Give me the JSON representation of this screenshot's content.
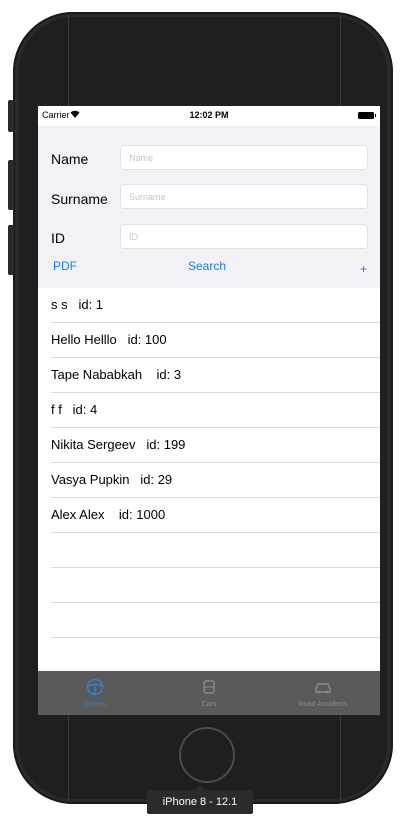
{
  "status_bar": {
    "carrier": "Carrier",
    "time": "12:02 PM"
  },
  "form": {
    "fields": [
      {
        "label": "Name",
        "placeholder": "Name",
        "value": ""
      },
      {
        "label": "Surname",
        "placeholder": "Surname",
        "value": ""
      },
      {
        "label": "ID",
        "placeholder": "ID",
        "value": ""
      }
    ],
    "pdf_label": "PDF",
    "search_label": "Search",
    "add_label": "+"
  },
  "drivers": [
    "s s   id: 1",
    "Hello Helllo   id: 100",
    "Tape Nababkah    id: 3",
    "f f   id: 4",
    "Nikita Sergeev   id: 199",
    "Vasya Pupkin   id: 29",
    "Alex Alex    id: 1000"
  ],
  "tabs": [
    {
      "label": "Drivers",
      "icon": "steering-wheel-icon",
      "active": true
    },
    {
      "label": "Cars",
      "icon": "car-icon",
      "active": false
    },
    {
      "label": "Road Accidents",
      "icon": "car-crash-icon",
      "active": false
    }
  ],
  "device_label": "iPhone 8 - 12.1",
  "colors": {
    "accent": "#1a7cf2",
    "tab_active": "#2f7fd4",
    "tabbar_bg": "#5a5a5a",
    "form_bg": "#f2f2f6"
  }
}
